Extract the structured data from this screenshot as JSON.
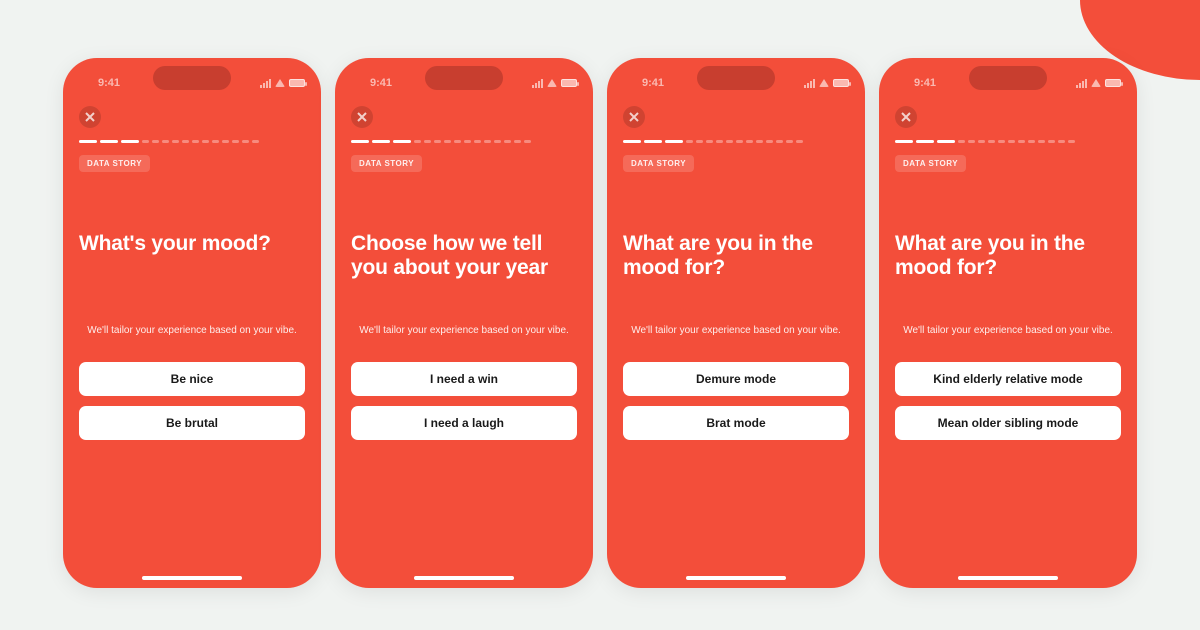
{
  "status_time": "9:41",
  "pill_label": "DATA STORY",
  "subtitle": "We'll tailor your experience based on your vibe.",
  "screens": [
    {
      "headline": "What's your mood?",
      "options": [
        "Be nice",
        "Be brutal"
      ]
    },
    {
      "headline": "Choose how we tell you about your year",
      "options": [
        "I need a win",
        "I need a laugh"
      ]
    },
    {
      "headline": "What are you in the mood for?",
      "options": [
        "Demure mode",
        "Brat mode"
      ]
    },
    {
      "headline": "What are you in the mood for?",
      "options": [
        "Kind elderly relative mode",
        "Mean older sibling mode"
      ]
    }
  ]
}
